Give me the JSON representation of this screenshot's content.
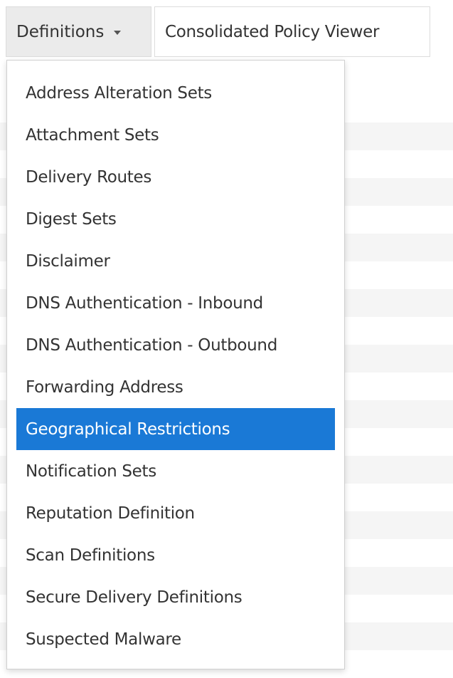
{
  "toolbar": {
    "definitions_label": "Definitions",
    "consolidated_label": "Consolidated Policy Viewer"
  },
  "dropdown": {
    "items": [
      {
        "label": "Address Alteration Sets"
      },
      {
        "label": "Attachment Sets"
      },
      {
        "label": "Delivery Routes"
      },
      {
        "label": "Digest Sets"
      },
      {
        "label": "Disclaimer"
      },
      {
        "label": "DNS Authentication - Inbound"
      },
      {
        "label": "DNS Authentication - Outbound"
      },
      {
        "label": "Forwarding Address"
      },
      {
        "label": "Geographical Restrictions"
      },
      {
        "label": "Notification Sets"
      },
      {
        "label": "Reputation Definition"
      },
      {
        "label": "Scan Definitions"
      },
      {
        "label": "Secure Delivery Definitions"
      },
      {
        "label": "Suspected Malware"
      }
    ],
    "active_item": "Geographical Restrictions"
  },
  "colors": {
    "active_bg": "#1a79d6",
    "active_text": "#ffffff",
    "button_bg": "#ebebeb",
    "row_shade": "#f5f5f5"
  },
  "icons": {
    "dropdown_caret": "caret-down-icon"
  }
}
